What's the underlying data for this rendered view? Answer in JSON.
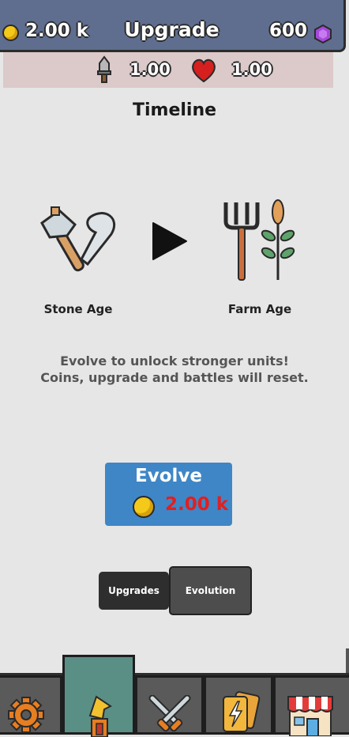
{
  "header": {
    "coins": "2.00 k",
    "title": "Upgrade",
    "gems": "600"
  },
  "stats": {
    "attack": "1.00",
    "health": "1.00"
  },
  "timeline": {
    "title": "Timeline",
    "current_age": "Stone Age",
    "next_age": "Farm Age",
    "description_line1": "Evolve to unlock stronger units!",
    "description_line2": "Coins, upgrade and battles will reset."
  },
  "evolve": {
    "label": "Evolve",
    "cost": "2.00 k"
  },
  "tabs": {
    "upgrades": "Upgrades",
    "evolution": "Evolution"
  },
  "nav": {
    "items": [
      "settings-icon",
      "upgrade-icon",
      "battle-icon",
      "cards-icon",
      "shop-icon"
    ],
    "active_index": 1
  },
  "colors": {
    "header": "#5f6e8f",
    "evolve_button": "#3f86c6",
    "cost_text": "#e02020",
    "active_nav": "#5a8f86"
  }
}
